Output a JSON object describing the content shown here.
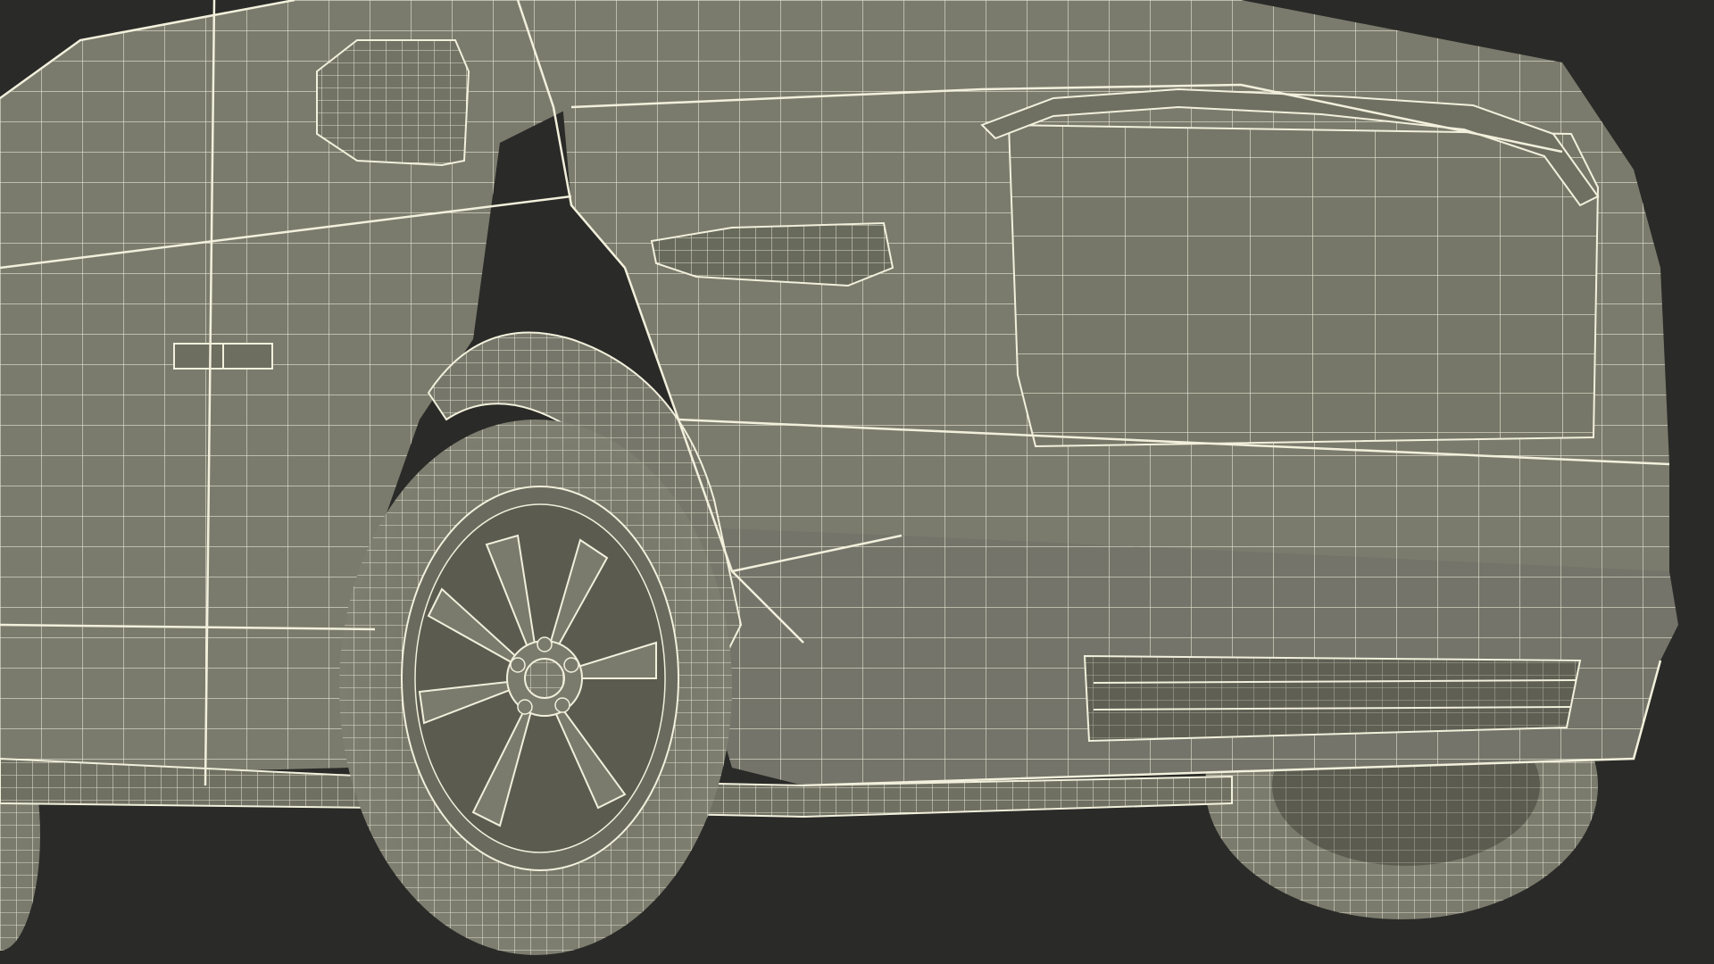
{
  "scene": {
    "subject": "wireframe-vehicle",
    "colors": {
      "background": "#2a2a28",
      "surface": "#7b7b6d",
      "surface_dark": "#6a6a5e",
      "wire": "#f2f0dc",
      "recess": "#5b5b50"
    }
  }
}
